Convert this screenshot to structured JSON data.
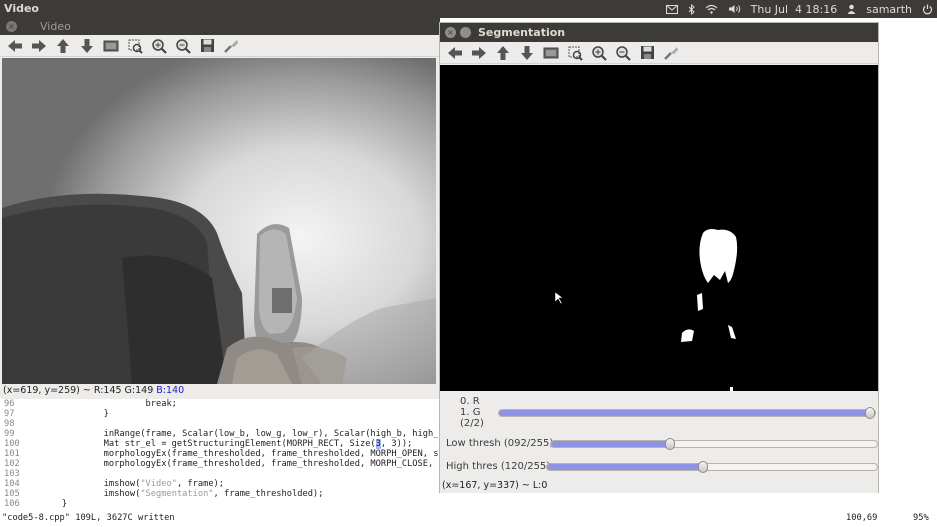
{
  "top_panel": {
    "app_title": "Video",
    "clock": "Thu Jul  4 18:16",
    "user": "samarth",
    "tray_icons": [
      "mail-icon",
      "bluetooth-icon",
      "wifi-icon",
      "volume-icon",
      "power-icon"
    ]
  },
  "video_window": {
    "title": "Video",
    "status_coords": "(x=619, y=259)",
    "status_rgb_prefix": " ~ R:145 G:149 ",
    "status_b": "B:140"
  },
  "toolbar_icons": [
    "arrow-left-icon",
    "arrow-right-icon",
    "arrow-up-icon",
    "arrow-down-icon",
    "fit-window-icon",
    "zoom-region-icon",
    "zoom-in-icon",
    "zoom-out-icon",
    "save-icon",
    "properties-icon"
  ],
  "segmentation_window": {
    "title": "Segmentation",
    "channel_r": "0. R",
    "channel_g": "1. G",
    "channel_count": "(2/2)",
    "low_thresh_label": "Low thresh (092/255)",
    "low_thresh_value": 92,
    "high_thresh_label": "High thres (120/255)",
    "high_thresh_value": 120,
    "channel_slider_value": 1,
    "status_text": "(x=167, y=337) ~ L:0"
  },
  "editor": {
    "lines": [
      {
        "num": "96",
        "code": "                        break;"
      },
      {
        "num": "97",
        "code": "                }"
      },
      {
        "num": "98",
        "code": ""
      },
      {
        "num": "99",
        "code": "                inRange(frame, Scalar(low_b, low_g, low_r), Scalar(high_b, high_g, high"
      },
      {
        "num": "100",
        "code": "                Mat str_el = getStructuringElement(MORPH_RECT, Size(",
        "hl": "3",
        "after_hl": ", 3));"
      },
      {
        "num": "101",
        "code": "                morphologyEx(frame_thresholded, frame_thresholded, MORPH_OPEN, str_el);"
      },
      {
        "num": "102",
        "code": "                morphologyEx(frame_thresholded, frame_thresholded, MORPH_CLOSE, str_el);"
      },
      {
        "num": "103",
        "code": ""
      },
      {
        "num": "104",
        "code": "                imshow(",
        "str": "\"Video\"",
        "after_str": ", frame);"
      },
      {
        "num": "105",
        "code": "                imshow(",
        "str": "\"Segmentation\"",
        "after_str": ", frame_thresholded);"
      },
      {
        "num": "106",
        "code": "        }"
      }
    ],
    "status_file": "\"code5-8.cpp\" 109L, 3627C written",
    "status_pos": "100,69",
    "status_pct": "95%"
  }
}
